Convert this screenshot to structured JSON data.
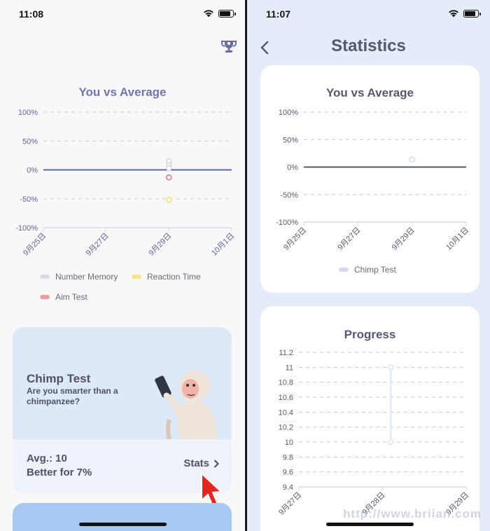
{
  "left_screen": {
    "status": {
      "time": "11:08"
    },
    "trophy_icon": "trophy-icon",
    "chart_title": "You vs Average",
    "legend": [
      {
        "label": "Number Memory",
        "color": "#d8dbe6"
      },
      {
        "label": "Reaction Time",
        "color": "#f4e68a"
      },
      {
        "label": "Aim Test",
        "color": "#ef9a9a"
      }
    ],
    "card": {
      "title": "Chimp Test",
      "subtitle": "Are you smarter than a chimpanzee?",
      "avg": "Avg.: 10",
      "better": "Better for  7%",
      "stats_label": "Stats"
    }
  },
  "right_screen": {
    "status": {
      "time": "11:07"
    },
    "nav_title": "Statistics",
    "chart1_title": "You vs Average",
    "chart1_legend": "Chimp Test",
    "chart2_title": "Progress",
    "watermark": "http://www.briian.com"
  },
  "chart_data": [
    {
      "type": "scatter",
      "title": "You vs Average",
      "y_ticks": [
        "100%",
        "50%",
        "0%",
        "-50%",
        "-100%"
      ],
      "x_ticks": [
        "9月25日",
        "9月27日",
        "9月29日",
        "10月1日"
      ],
      "ylim": [
        -100,
        100
      ],
      "series": [
        {
          "name": "Number Memory",
          "color": "#d0d4e4",
          "points": [
            [
              2.0,
              15
            ],
            [
              2.0,
              8
            ],
            [
              2.0,
              3
            ]
          ]
        },
        {
          "name": "Reaction Time",
          "color": "#f1df6e",
          "points": [
            [
              2.0,
              -52
            ]
          ]
        },
        {
          "name": "Aim Test",
          "color": "#e57373",
          "points": [
            [
              2.0,
              -13
            ]
          ]
        }
      ]
    },
    {
      "type": "scatter",
      "title": "You vs Average",
      "y_ticks": [
        "100%",
        "50%",
        "0%",
        "-50%",
        "-100%"
      ],
      "x_ticks": [
        "9月25日",
        "9月27日",
        "9月29日",
        "10月1日"
      ],
      "ylim": [
        -100,
        100
      ],
      "series": [
        {
          "name": "Chimp Test",
          "color": "#d5d9f0",
          "points": [
            [
              2.0,
              14
            ]
          ]
        }
      ]
    },
    {
      "type": "line",
      "title": "Progress",
      "y_ticks": [
        "11.2",
        "11",
        "10.8",
        "10.6",
        "10.4",
        "10.2",
        "10",
        "9.8",
        "9.6",
        "9.4"
      ],
      "x_ticks": [
        "9月27日",
        "9月28日",
        "9月29日"
      ],
      "ylim": [
        9.4,
        11.2
      ],
      "series": [
        {
          "name": "Chimp Test",
          "color": "#dbe6f5",
          "points": [
            [
              1.1,
              11
            ],
            [
              1.1,
              10
            ]
          ]
        }
      ]
    }
  ]
}
